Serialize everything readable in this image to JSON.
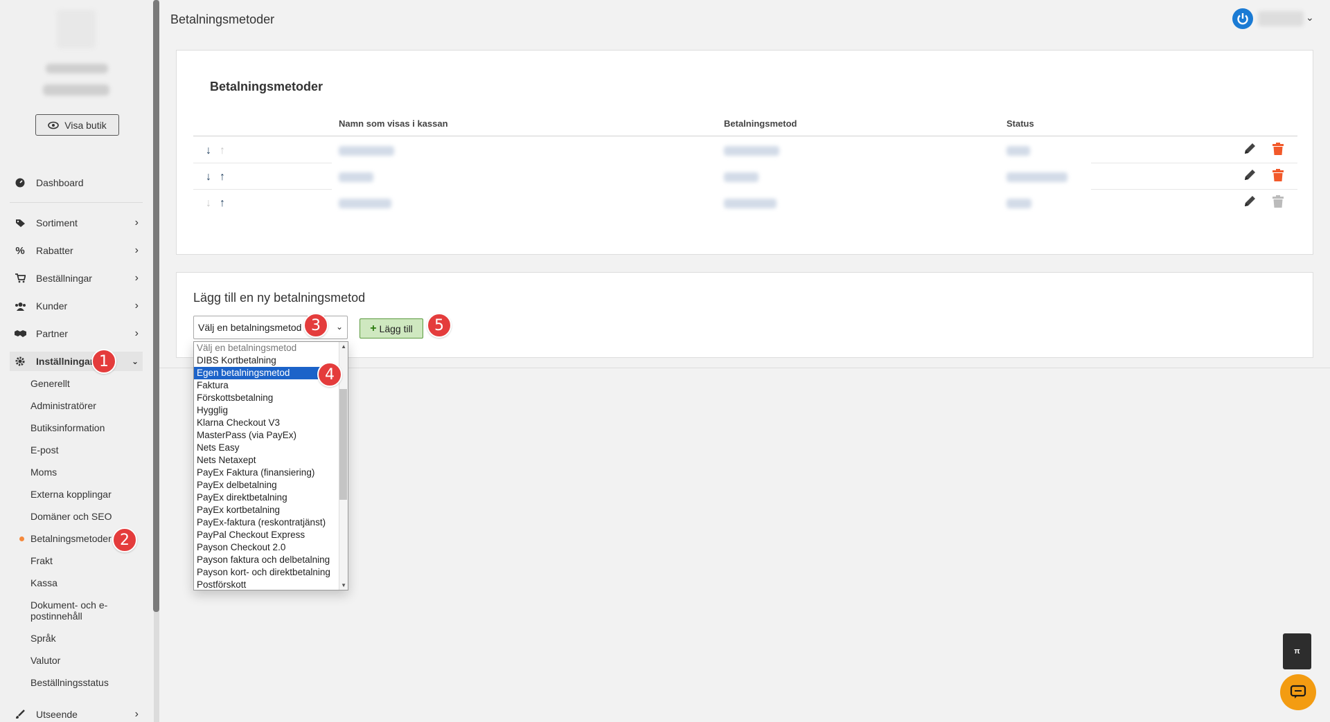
{
  "sidebar": {
    "visa_button": "Visa butik",
    "nav": [
      {
        "label": "Dashboard"
      },
      {
        "label": "Sortiment"
      },
      {
        "label": "Rabatter"
      },
      {
        "label": "Beställningar"
      },
      {
        "label": "Kunder"
      },
      {
        "label": "Partner"
      },
      {
        "label": "Inställningar"
      },
      {
        "label": "Utseende"
      }
    ],
    "sub": [
      "Generellt",
      "Administratörer",
      "Butiksinformation",
      "E-post",
      "Moms",
      "Externa kopplingar",
      "Domäner och SEO",
      "Betalningsmetoder",
      "Frakt",
      "Kassa",
      "Dokument- och e-",
      "postinnehåll",
      "Språk",
      "Valutor",
      "Beställningsstatus"
    ]
  },
  "header": {
    "title": "Betalningsmetoder"
  },
  "methods_card": {
    "title": "Betalningsmetoder",
    "columns": [
      "Namn som visas i kassan",
      "Betalningsmetod",
      "Status"
    ]
  },
  "add_card": {
    "title": "Lägg till en ny betalningsmetod",
    "select_value": "Välj en betalningsmetod",
    "add_button": "Lägg till"
  },
  "dropdown_options": [
    "Välj en betalningsmetod",
    "DIBS Kortbetalning",
    "Egen betalningsmetod",
    "Faktura",
    "Förskottsbetalning",
    "Hygglig",
    "Klarna Checkout V3",
    "MasterPass (via PayEx)",
    "Nets Easy",
    "Nets Netaxept",
    "PayEx Faktura (finansiering)",
    "PayEx delbetalning",
    "PayEx direktbetalning",
    "PayEx kortbetalning",
    "PayEx-faktura (reskontratjänst)",
    "PayPal Checkout Express",
    "Payson Checkout 2.0",
    "Payson faktura och delbetalning",
    "Payson kort- och direktbetalning",
    "Postförskott"
  ],
  "badges": [
    "1",
    "2",
    "3",
    "4",
    "5"
  ],
  "float_label": "π",
  "colors": {
    "accent_blue": "#1c63c9",
    "delete_orange": "#f2592a",
    "badge_red": "#e43c3c",
    "add_green": "#cfe8c0"
  }
}
